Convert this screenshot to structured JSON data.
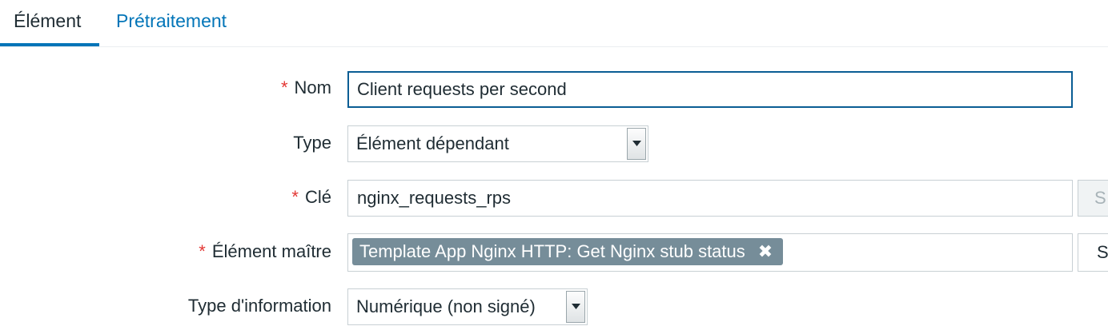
{
  "tabs": [
    {
      "label": "Élément",
      "active": true
    },
    {
      "label": "Prétraitement",
      "active": false
    }
  ],
  "form": {
    "name": {
      "label": "Nom",
      "required": true,
      "value": "Client requests per second"
    },
    "type": {
      "label": "Type",
      "required": false,
      "value": "Élément dépendant"
    },
    "key": {
      "label": "Clé",
      "required": true,
      "value": "nginx_requests_rps",
      "button_label": "S"
    },
    "master": {
      "label": "Élément maître",
      "required": true,
      "token": "Template App Nginx HTTP: Get Nginx stub status",
      "button_label": "S"
    },
    "info_type": {
      "label": "Type d'information",
      "required": false,
      "value": "Numérique (non signé)"
    }
  },
  "required_marker": "*",
  "remove_glyph": "✖",
  "colors": {
    "accent": "#0275b8",
    "required": "#e33734",
    "token_bg": "#768d99"
  }
}
